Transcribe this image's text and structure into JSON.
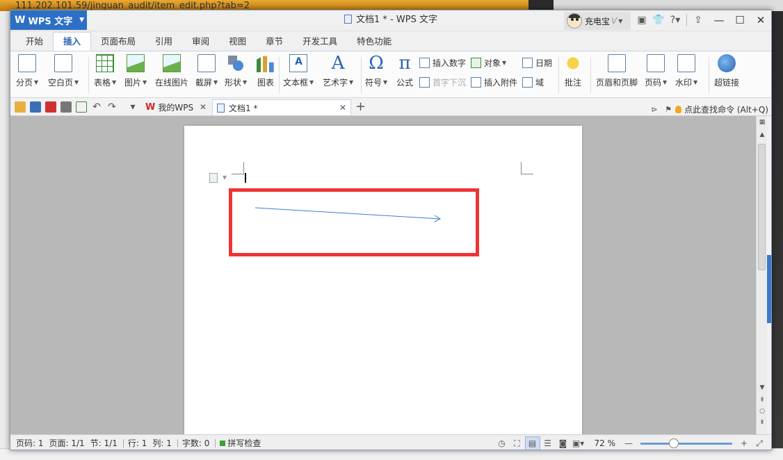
{
  "background": {
    "url": "111.202.101.59/jinguan_audit/item_edit.php?tab=2"
  },
  "window": {
    "app_name": "WPS 文字",
    "title": "文档1 * - WPS 文字",
    "user_name": "充电宝",
    "controls": {
      "minimize": "—",
      "maximize": "☐",
      "close": "✕"
    }
  },
  "ribbon": {
    "tabs": [
      {
        "label": "开始",
        "active": false
      },
      {
        "label": "插入",
        "active": true
      },
      {
        "label": "页面布局",
        "active": false
      },
      {
        "label": "引用",
        "active": false
      },
      {
        "label": "审阅",
        "active": false
      },
      {
        "label": "视图",
        "active": false
      },
      {
        "label": "章节",
        "active": false
      },
      {
        "label": "开发工具",
        "active": false
      },
      {
        "label": "特色功能",
        "active": false
      }
    ],
    "buttons": {
      "page_break": "分页",
      "blank_page": "空白页",
      "table": "表格",
      "picture": "图片",
      "online_picture": "在线图片",
      "screenshot": "截屏",
      "shape": "形状",
      "chart": "图表",
      "text_box": "文本框",
      "word_art": "艺术字",
      "symbol": "符号",
      "formula": "公式",
      "insert_number": "插入数字",
      "drop_cap": "首字下沉",
      "object": "对象",
      "insert_attachment": "插入附件",
      "date": "日期",
      "field": "域",
      "comment": "批注",
      "header_footer": "页眉和页脚",
      "page_number": "页码",
      "watermark": "水印",
      "hyperlink": "超链接"
    },
    "glyphs": {
      "symbol": "Ω",
      "formula": "π",
      "word_art": "A"
    }
  },
  "quickbar": {
    "doc_tabs": [
      {
        "label": "我的WPS",
        "active": false
      },
      {
        "label": "文档1 *",
        "active": true
      }
    ],
    "find_command": "点此查找命令 (Alt+Q)"
  },
  "statusbar": {
    "page_code": "页码: 1",
    "pages": "页面: 1/1",
    "section": "节: 1/1",
    "row": "行: 1",
    "col": "列: 1",
    "word_count": "字数: 0",
    "spell_check": "拼写检查",
    "zoom": "72 %",
    "zoom_fraction": 0.36
  },
  "colors": {
    "accent": "#2d6fc4",
    "highlight_box": "#ee3434",
    "arrow": "#3a7ec8"
  }
}
